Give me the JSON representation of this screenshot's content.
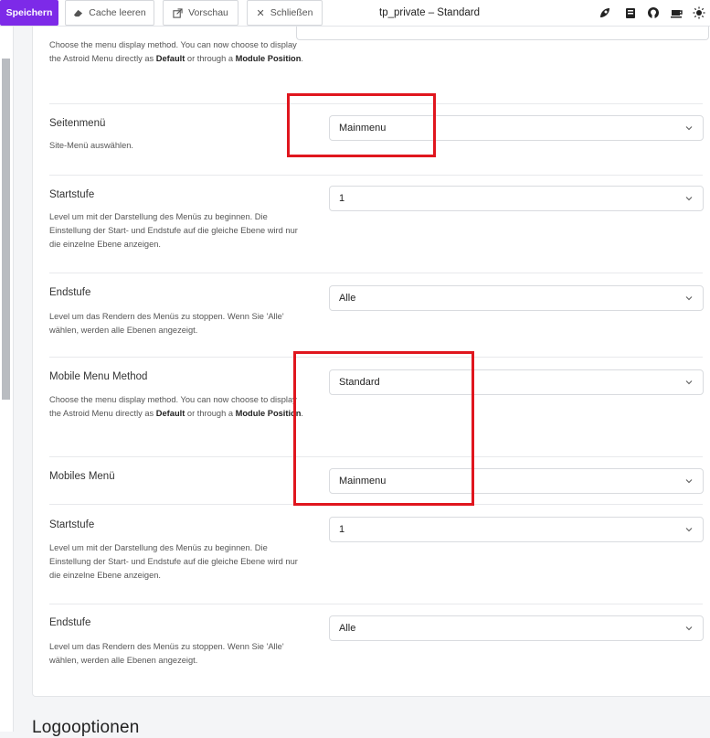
{
  "toolbar": {
    "save_label": "Speichern",
    "cache_label": "Cache leeren",
    "preview_label": "Vorschau",
    "close_label": "Schließen",
    "title": "tp_private – Standard",
    "save_color": "#7d2ae8",
    "right_icons": [
      "rocket-icon",
      "book-icon",
      "github-icon",
      "coffee-icon",
      "sun-icon"
    ]
  },
  "intro": {
    "desc_1": "Choose the menu display method. You can now choose to display the Astroid Menu directly as ",
    "desc_default": "Default",
    "desc_2": " or through a ",
    "desc_module": "Module Position",
    "desc_3": "."
  },
  "fields": [
    {
      "label": "Seitenmenü",
      "desc": "Site-Menü auswählen.",
      "value": "Mainmenu"
    },
    {
      "label": "Startstufe",
      "desc": "Level um mit der Darstellung des Menüs zu beginnen. Die Einstellung der Start- und Endstufe auf die gleiche Ebene wird nur die einzelne Ebene anzeigen.",
      "value": "1"
    },
    {
      "label": "Endstufe",
      "desc": "Level um das Rendern des Menüs zu stoppen. Wenn Sie 'Alle' wählen, werden alle Ebenen angezeigt.",
      "value": "Alle"
    },
    {
      "label": "Mobile Menu Method",
      "desc_1": "Choose the menu display method. You can now choose to display the Astroid Menu directly as ",
      "desc_default": "Default",
      "desc_2": " or through a ",
      "desc_module": "Module Position",
      "desc_3": ".",
      "value": "Standard"
    },
    {
      "label": "Mobiles Menü",
      "value": "Mainmenu"
    },
    {
      "label": "Startstufe",
      "desc": "Level um mit der Darstellung des Menüs zu beginnen. Die Einstellung der Start- und Endstufe auf die gleiche Ebene wird nur die einzelne Ebene anzeigen.",
      "value": "1"
    },
    {
      "label": "Endstufe",
      "desc": "Level um das Rendern des Menüs zu stoppen. Wenn Sie 'Alle' wählen, werden alle Ebenen angezeigt.",
      "value": "Alle"
    }
  ],
  "next_section_title": "Logooptionen",
  "highlight_color": "#e0161e"
}
